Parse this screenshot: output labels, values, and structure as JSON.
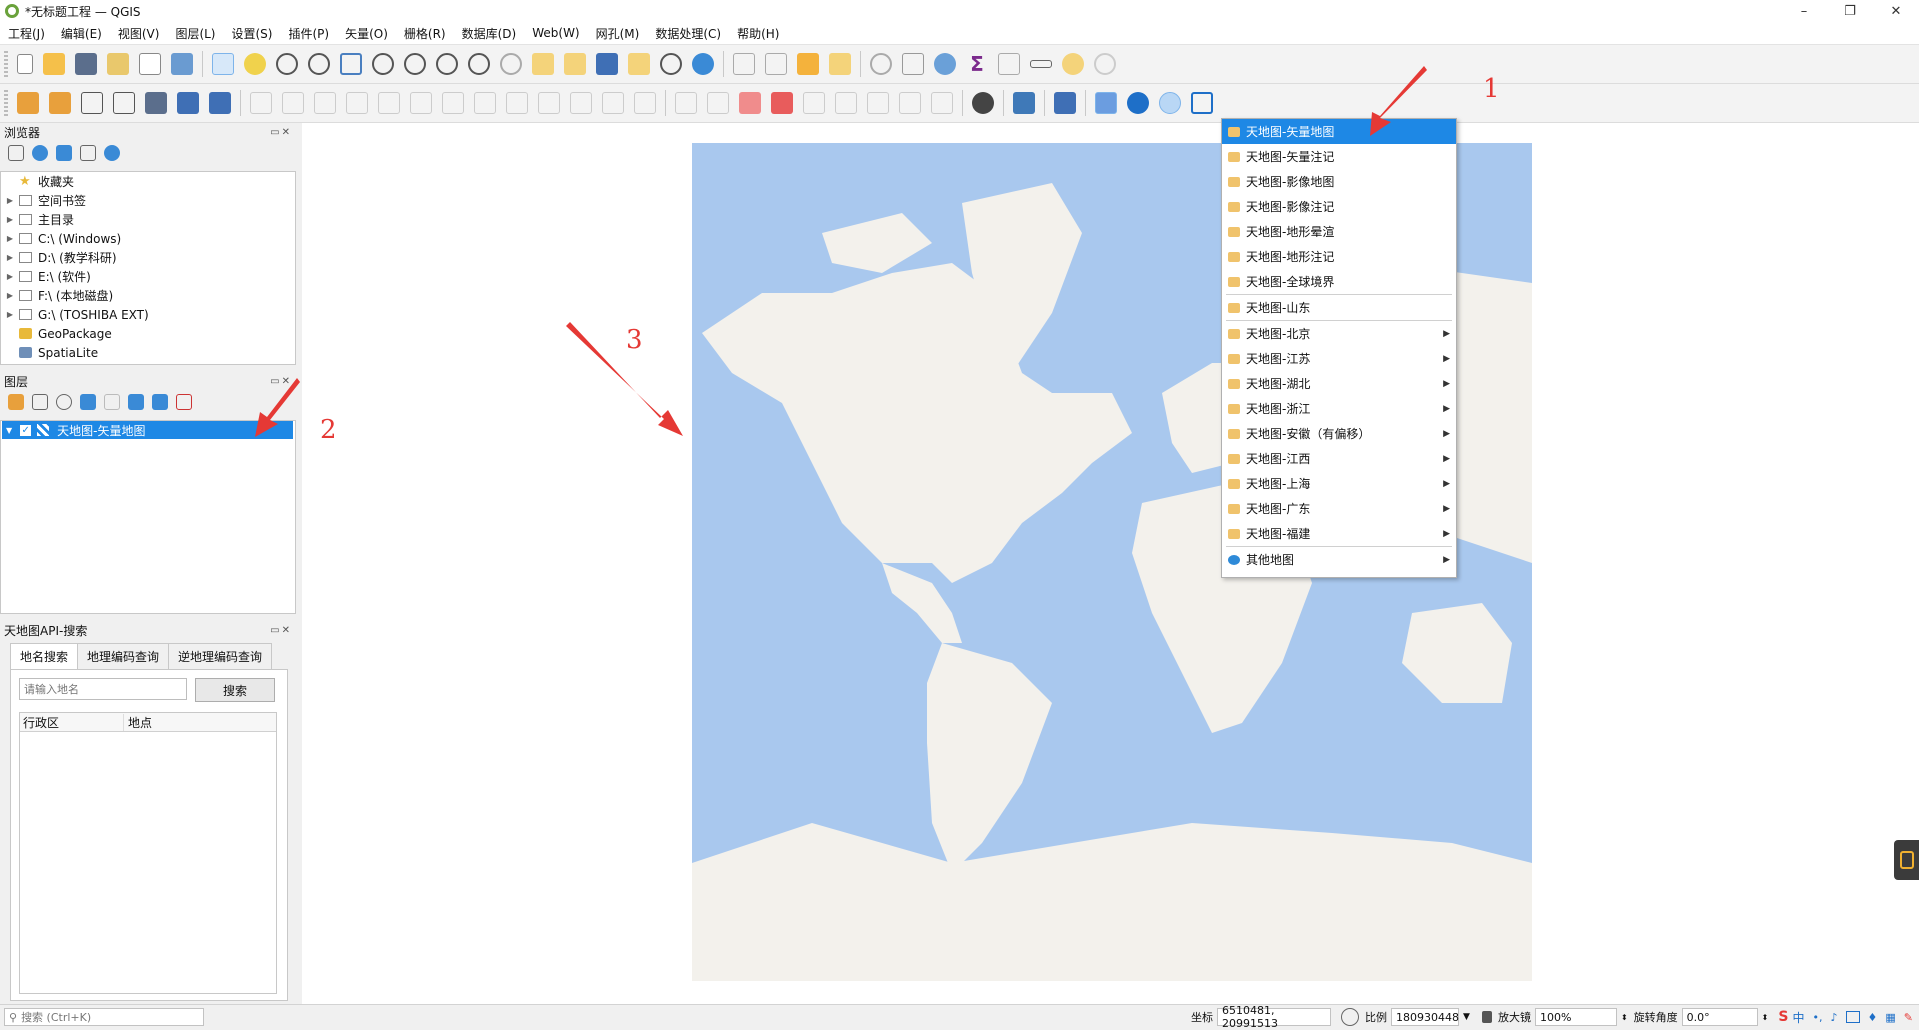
{
  "window": {
    "title": "*无标题工程 — QGIS",
    "min": "–",
    "max": "❐",
    "close": "✕"
  },
  "menubar": [
    "工程(J)",
    "编辑(E)",
    "视图(V)",
    "图层(L)",
    "设置(S)",
    "插件(P)",
    "矢量(O)",
    "栅格(R)",
    "数据库(D)",
    "Web(W)",
    "网孔(M)",
    "数据处理(C)",
    "帮助(H)"
  ],
  "browser": {
    "title": "浏览器",
    "items": [
      {
        "label": "收藏夹",
        "icon": "star-icon"
      },
      {
        "label": "空间书签",
        "icon": "bookmark-icon"
      },
      {
        "label": "主目录",
        "icon": "home-icon"
      },
      {
        "label": "C:\\ (Windows)",
        "icon": "folder-icon"
      },
      {
        "label": "D:\\ (教学科研)",
        "icon": "folder-icon"
      },
      {
        "label": "E:\\ (软件)",
        "icon": "folder-icon"
      },
      {
        "label": "F:\\ (本地磁盘)",
        "icon": "folder-icon"
      },
      {
        "label": "G:\\ (TOSHIBA EXT)",
        "icon": "folder-icon"
      },
      {
        "label": "GeoPackage",
        "icon": "geopackage-icon"
      },
      {
        "label": "SpatiaLite",
        "icon": "spatialite-icon"
      }
    ]
  },
  "layers": {
    "title": "图层",
    "items": [
      {
        "label": "天地图-矢量地图",
        "checked": true
      }
    ]
  },
  "search_panel": {
    "title": "天地图API-搜索",
    "tabs": [
      "地名搜索",
      "地理编码查询",
      "逆地理编码查询"
    ],
    "placeholder": "请输入地名",
    "search_button": "搜索",
    "columns": [
      "行政区",
      "地点"
    ]
  },
  "dropdown": {
    "items": [
      {
        "label": "天地图-矢量地图",
        "selected": true,
        "submenu": false
      },
      {
        "label": "天地图-矢量注记",
        "submenu": false
      },
      {
        "label": "天地图-影像地图",
        "submenu": false
      },
      {
        "label": "天地图-影像注记",
        "submenu": false
      },
      {
        "label": "天地图-地形晕渲",
        "submenu": false
      },
      {
        "label": "天地图-地形注记",
        "submenu": false
      },
      {
        "label": "天地图-全球境界",
        "submenu": false
      },
      {
        "label": "天地图-山东",
        "submenu": false,
        "sep_before": true
      },
      {
        "label": "天地图-北京",
        "submenu": true,
        "sep_before": true
      },
      {
        "label": "天地图-江苏",
        "submenu": true
      },
      {
        "label": "天地图-湖北",
        "submenu": true
      },
      {
        "label": "天地图-浙江",
        "submenu": true
      },
      {
        "label": "天地图-安徽（有偏移）",
        "submenu": true
      },
      {
        "label": "天地图-江西",
        "submenu": true
      },
      {
        "label": "天地图-上海",
        "submenu": true
      },
      {
        "label": "天地图-广东",
        "submenu": true
      },
      {
        "label": "天地图-福建",
        "submenu": true
      },
      {
        "label": "其他地图",
        "submenu": true,
        "sep_before": true,
        "icon": "globe-icon"
      }
    ]
  },
  "annotations": [
    "1",
    "2",
    "3"
  ],
  "statusbar": {
    "search_placeholder": "搜索 (Ctrl+K)",
    "coord_label": "坐标",
    "coord_value": "6510481, 20991513",
    "scale_label": "比例",
    "scale_value": "180930448",
    "magnifier_label": "放大镜",
    "magnifier_value": "100%",
    "rotation_label": "旋转角度",
    "rotation_value": "0.0°",
    "ime": "中"
  },
  "colors": {
    "accent": "#1e88e5",
    "ocean": "#a9c8ee",
    "land": "#f3f1ec",
    "arrow": "#e53935"
  }
}
